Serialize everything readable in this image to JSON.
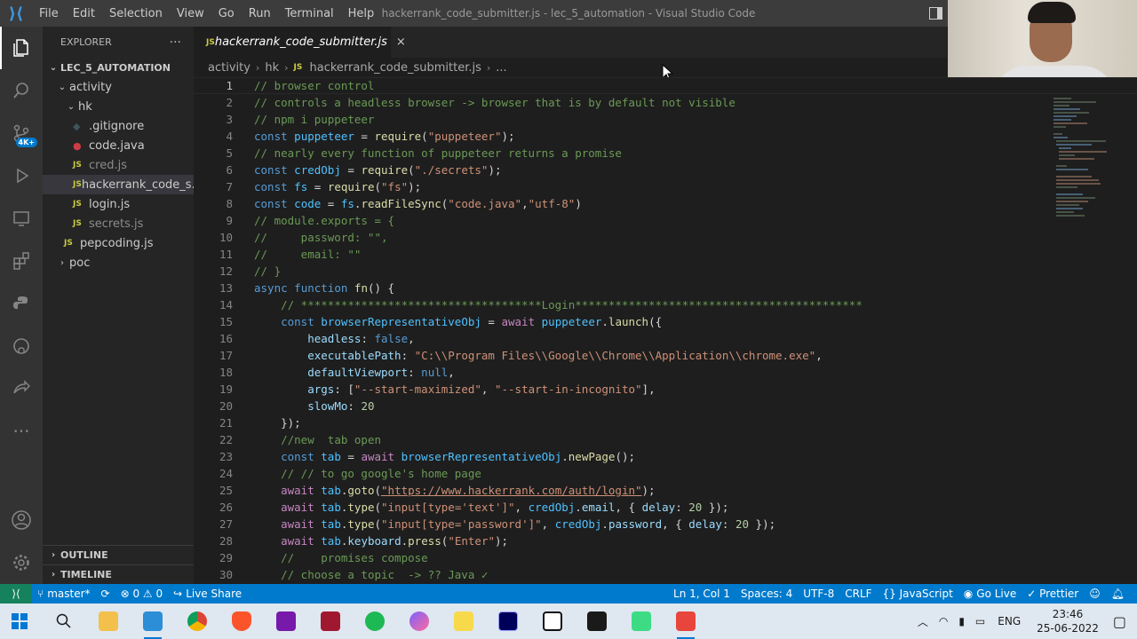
{
  "titlebar": {
    "menu": [
      "File",
      "Edit",
      "Selection",
      "View",
      "Go",
      "Run",
      "Terminal",
      "Help"
    ],
    "title": "hackerrank_code_submitter.js - lec_5_automation - Visual Studio Code"
  },
  "activitybar": {
    "icons": [
      "explorer-icon",
      "search-icon",
      "source-control-icon",
      "run-debug-icon",
      "remote-explorer-icon",
      "extensions-icon",
      "python-icon",
      "github-icon",
      "live-share-icon",
      "more-icon",
      "account-icon",
      "settings-gear-icon"
    ],
    "scm_badge": "4K+"
  },
  "sidebar": {
    "title": "EXPLORER",
    "more": "···",
    "root": "LEC_5_AUTOMATION",
    "items": [
      {
        "label": "activity"
      },
      {
        "label": "hk"
      },
      {
        "label": ".gitignore"
      },
      {
        "label": "code.java"
      },
      {
        "label": "cred.js"
      },
      {
        "label": "hackerrank_code_s..."
      },
      {
        "label": "login.js"
      },
      {
        "label": "secrets.js"
      },
      {
        "label": "pepcoding.js"
      },
      {
        "label": "poc"
      }
    ],
    "outline": "OUTLINE",
    "timeline": "TIMELINE"
  },
  "tabs": [
    {
      "label": "hackerrank_code_submitter.js",
      "close": "×"
    }
  ],
  "breadcrumb": [
    "activity",
    "hk",
    "hackerrank_code_submitter.js",
    "..."
  ],
  "editor": {
    "line_numbers": [
      "1",
      "2",
      "3",
      "4",
      "5",
      "6",
      "7",
      "8",
      "9",
      "10",
      "11",
      "12",
      "13",
      "14",
      "15",
      "16",
      "17",
      "18",
      "19",
      "20",
      "21",
      "22",
      "23",
      "24",
      "25",
      "26",
      "27",
      "28",
      "29",
      "30"
    ],
    "current_line": "1"
  },
  "statusbar": {
    "branch": "master*",
    "problems": "⊗ 0 ⚠ 0",
    "live_share": "Live Share",
    "position": "Ln 1, Col 1",
    "spaces": "Spaces: 4",
    "encoding": "UTF-8",
    "eol": "CRLF",
    "language": "{} JavaScript",
    "go_live": "Go Live",
    "prettier": "✓ Prettier"
  },
  "taskbar": {
    "tray_lang": "ENG",
    "time": "23:46",
    "date": "25-06-2022"
  },
  "colors": {
    "accent": "#007acc",
    "remote": "#16825d",
    "comment": "#6a9955",
    "keyword": "#569cd6",
    "string": "#ce9178",
    "variable": "#9cdcfe",
    "function": "#dcdcaa",
    "number": "#b5cea8"
  }
}
